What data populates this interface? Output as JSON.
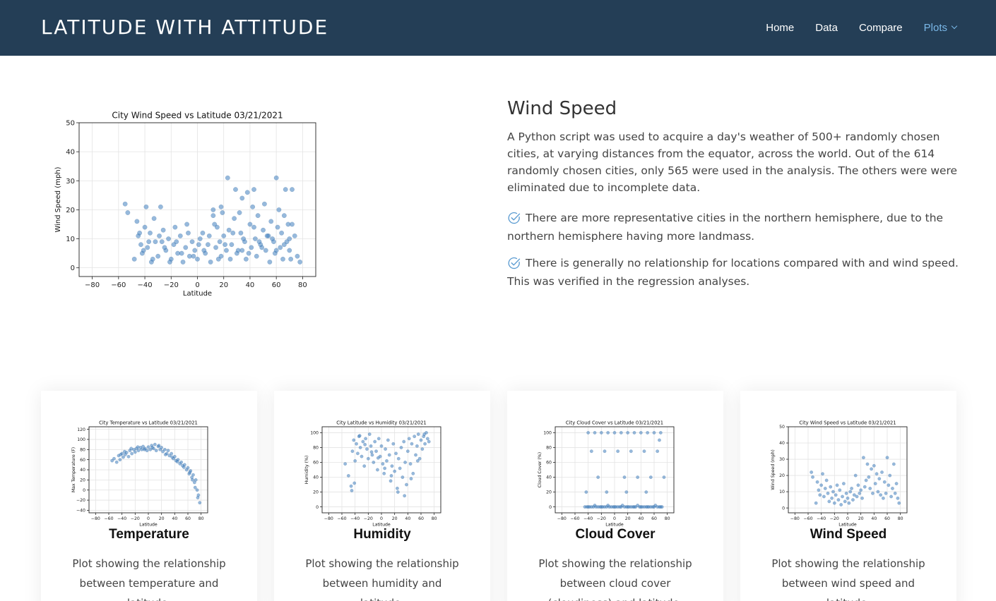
{
  "header": {
    "logo": "LATITUDE WITH ATTITUDE",
    "nav": [
      {
        "label": "Home"
      },
      {
        "label": "Data"
      },
      {
        "label": "Compare"
      },
      {
        "label": "Plots"
      }
    ]
  },
  "main": {
    "title": "Wind Speed",
    "description": "A Python script was used to acquire a day's weather of 500+ randomly chosen cities, at varying distances from the equator, across the world. Out of the 614 randomly chosen cities, only 565 were used in the analysis. The others were were eliminated due to incomplete data.",
    "points": [
      {
        "text": "There are more representative cities in the northern hemisphere, due to the northern hemisphere having more landmass.",
        "icon": "check-circle-icon"
      },
      {
        "text": "There is generally no relationship for locations compared with and wind speed. This was verified in the regression analyses.",
        "icon": "check-circle-icon"
      }
    ]
  },
  "cards": [
    {
      "title": "Temperature",
      "description": "Plot showing the relationship between temperature and latitude."
    },
    {
      "title": "Humidity",
      "description": "Plot showing the relationship between humidity and latitude."
    },
    {
      "title": "Cloud Cover",
      "description": "Plot showing the relationship between cloud cover (cloudiness) and latitude."
    },
    {
      "title": "Wind Speed",
      "description": "Plot showing the relationship between wind speed and latitude."
    }
  ],
  "colors": {
    "header_bg": "#243e56",
    "accent": "#7ab8e8",
    "point": "#3f7fbf"
  },
  "chart_data": [
    {
      "type": "scatter",
      "title": "City Wind Speed vs Latitude 03/21/2021",
      "xlabel": "Latitude",
      "ylabel": "Wind Speed (mph)",
      "xlim": [
        -90,
        90
      ],
      "ylim": [
        -3,
        50
      ],
      "xticks": [
        -80,
        -60,
        -40,
        -20,
        0,
        20,
        40,
        60,
        80
      ],
      "yticks": [
        0,
        10,
        20,
        30,
        40,
        50
      ],
      "grid": true,
      "x": [
        -55,
        -53,
        -48,
        -46,
        -45,
        -43,
        -42,
        -40,
        -39,
        -38,
        -36,
        -35,
        -33,
        -32,
        -30,
        -28,
        -26,
        -24,
        -22,
        -20,
        -18,
        -17,
        -15,
        -13,
        -11,
        -9,
        -8,
        -6,
        -4,
        -2,
        0,
        2,
        4,
        6,
        8,
        10,
        12,
        14,
        15,
        17,
        18,
        20,
        22,
        23,
        24,
        25,
        26,
        28,
        29,
        30,
        32,
        33,
        34,
        36,
        37,
        38,
        40,
        41,
        42,
        44,
        45,
        46,
        48,
        50,
        51,
        52,
        54,
        55,
        56,
        58,
        59,
        60,
        61,
        62,
        63,
        64,
        65,
        66,
        67,
        68,
        69,
        70,
        72,
        74,
        76,
        78,
        -44,
        -41,
        -37,
        -34,
        -29,
        -25,
        -21,
        -16,
        -12,
        -7,
        -3,
        1,
        5,
        9,
        13,
        16,
        19,
        21,
        27,
        31,
        35,
        39,
        43,
        47,
        49,
        53,
        57,
        60,
        66,
        71,
        -27,
        12,
        43,
        18,
        34,
        72,
        70
      ],
      "y": [
        22,
        19,
        3,
        16,
        11,
        8,
        5,
        14,
        21,
        7,
        12,
        2,
        17,
        9,
        4,
        21,
        13,
        6,
        10,
        3,
        8,
        14,
        5,
        11,
        2,
        7,
        15,
        4,
        9,
        6,
        3,
        10,
        12,
        5,
        8,
        2,
        20,
        7,
        14,
        9,
        4,
        11,
        6,
        31,
        13,
        3,
        8,
        17,
        27,
        5,
        19,
        12,
        24,
        9,
        3,
        26,
        15,
        7,
        21,
        10,
        4,
        18,
        8,
        13,
        22,
        6,
        11,
        2,
        16,
        9,
        5,
        31,
        14,
        20,
        7,
        12,
        3,
        18,
        27,
        9,
        15,
        6,
        27,
        11,
        4,
        2,
        12,
        6,
        9,
        3,
        11,
        7,
        2,
        9,
        5,
        12,
        4,
        8,
        6,
        11,
        15,
        3,
        19,
        8,
        12,
        6,
        10,
        5,
        14,
        9,
        7,
        11,
        10,
        6,
        8,
        3,
        9,
        18,
        27,
        21,
        6,
        15,
        10
      ]
    },
    {
      "type": "scatter",
      "title": "City Temperature vs Latitude 03/21/2021",
      "xlabel": "Latitude",
      "ylabel": "Max Temperature (F)",
      "xlim": [
        -90,
        90
      ],
      "ylim": [
        -45,
        125
      ],
      "xticks": [
        -80,
        -60,
        -40,
        -20,
        0,
        20,
        40,
        60,
        80
      ],
      "yticks": [
        -40,
        -20,
        0,
        20,
        40,
        60,
        80,
        100,
        120
      ],
      "grid": true,
      "x": [
        -55,
        -52,
        -48,
        -45,
        -43,
        -40,
        -38,
        -35,
        -33,
        -30,
        -28,
        -25,
        -22,
        -20,
        -18,
        -15,
        -12,
        -10,
        -8,
        -5,
        -2,
        0,
        3,
        5,
        8,
        10,
        12,
        15,
        18,
        20,
        22,
        25,
        28,
        30,
        32,
        35,
        38,
        40,
        42,
        45,
        48,
        50,
        52,
        55,
        58,
        60,
        62,
        64,
        66,
        68,
        70,
        72,
        74,
        76,
        78,
        -42,
        -36,
        -26,
        -16,
        -6,
        6,
        16,
        26,
        36,
        44,
        54,
        63,
        67,
        71,
        75
      ],
      "y": [
        58,
        62,
        55,
        68,
        60,
        72,
        65,
        70,
        74,
        66,
        78,
        72,
        80,
        75,
        82,
        78,
        84,
        80,
        86,
        82,
        78,
        85,
        80,
        88,
        82,
        90,
        78,
        86,
        80,
        84,
        76,
        80,
        72,
        78,
        68,
        72,
        62,
        66,
        58,
        60,
        52,
        55,
        48,
        50,
        40,
        44,
        32,
        38,
        25,
        30,
        15,
        20,
        0,
        -10,
        -25,
        70,
        76,
        82,
        85,
        80,
        84,
        88,
        70,
        65,
        56,
        45,
        35,
        20,
        5,
        -15
      ]
    },
    {
      "type": "scatter",
      "title": "City Latitude vs Humidity 03/21/2021",
      "xlabel": "Latitude",
      "ylabel": "Humidity (%)",
      "xlim": [
        -90,
        90
      ],
      "ylim": [
        -8,
        108
      ],
      "xticks": [
        -80,
        -60,
        -40,
        -20,
        0,
        20,
        40,
        60,
        80
      ],
      "yticks": [
        0,
        20,
        40,
        60,
        80,
        100
      ],
      "grid": true,
      "x": [
        -55,
        -50,
        -46,
        -44,
        -42,
        -40,
        -38,
        -36,
        -34,
        -32,
        -30,
        -28,
        -26,
        -24,
        -22,
        -20,
        -18,
        -16,
        -14,
        -12,
        -10,
        -8,
        -6,
        -4,
        -2,
        0,
        2,
        4,
        6,
        8,
        10,
        12,
        14,
        16,
        18,
        20,
        22,
        24,
        26,
        28,
        30,
        32,
        34,
        36,
        38,
        40,
        42,
        44,
        46,
        48,
        50,
        52,
        54,
        56,
        58,
        60,
        62,
        64,
        66,
        68,
        70,
        72,
        -45,
        -41,
        -33,
        -25,
        -15,
        -5,
        5,
        15,
        25,
        35,
        45,
        55,
        65
      ],
      "y": [
        58,
        42,
        28,
        75,
        90,
        62,
        85,
        72,
        95,
        80,
        68,
        88,
        55,
        92,
        78,
        65,
        98,
        82,
        70,
        60,
        88,
        75,
        50,
        92,
        68,
        82,
        58,
        45,
        78,
        62,
        90,
        70,
        35,
        55,
        85,
        48,
        72,
        25,
        65,
        52,
        80,
        40,
        88,
        60,
        30,
        75,
        92,
        58,
        85,
        45,
        95,
        70,
        82,
        98,
        65,
        90,
        78,
        95,
        85,
        100,
        92,
        88,
        22,
        32,
        96,
        84,
        74,
        66,
        52,
        42,
        20,
        15,
        38,
        62,
        98
      ]
    },
    {
      "type": "scatter",
      "title": "City Cloud Cover vs Latitude 03/21/2021",
      "xlabel": "Latitude",
      "ylabel": "Cloud Cover (%)",
      "xlim": [
        -90,
        90
      ],
      "ylim": [
        -8,
        108
      ],
      "xticks": [
        -80,
        -60,
        -40,
        -20,
        0,
        20,
        40,
        60,
        80
      ],
      "yticks": [
        0,
        20,
        40,
        60,
        80,
        100
      ],
      "grid": true,
      "x": [
        -45,
        -42,
        -40,
        -38,
        -35,
        -32,
        -30,
        -28,
        -25,
        -22,
        -20,
        -18,
        -15,
        -12,
        -10,
        -8,
        -5,
        -2,
        0,
        2,
        5,
        8,
        10,
        12,
        15,
        18,
        20,
        22,
        25,
        28,
        30,
        32,
        35,
        38,
        40,
        42,
        45,
        48,
        50,
        52,
        55,
        58,
        60,
        62,
        65,
        68,
        70,
        72,
        -40,
        -30,
        -20,
        -10,
        0,
        10,
        20,
        30,
        40,
        50,
        60,
        70,
        -35,
        -15,
        5,
        25,
        45,
        65,
        -25,
        15,
        35,
        55,
        75,
        -43,
        -12,
        18,
        48,
        68
      ],
      "y": [
        0,
        0,
        0,
        0,
        0,
        0,
        2,
        0,
        0,
        0,
        0,
        0,
        0,
        0,
        2,
        0,
        0,
        0,
        0,
        0,
        0,
        0,
        0,
        2,
        0,
        0,
        0,
        0,
        0,
        0,
        0,
        0,
        2,
        0,
        0,
        0,
        0,
        0,
        0,
        0,
        0,
        0,
        0,
        2,
        0,
        0,
        0,
        0,
        100,
        100,
        100,
        100,
        100,
        100,
        100,
        100,
        100,
        100,
        100,
        100,
        75,
        75,
        75,
        75,
        75,
        75,
        40,
        40,
        40,
        40,
        40,
        20,
        20,
        20,
        20,
        90
      ]
    },
    {
      "type": "scatter",
      "title": "City Wind Speed vs Latitude 03/21/2021",
      "xlabel": "Latitude",
      "ylabel": "Wind Speed (mph)",
      "xlim": [
        -90,
        90
      ],
      "ylim": [
        -3,
        50
      ],
      "xticks": [
        -80,
        -60,
        -40,
        -20,
        0,
        20,
        40,
        60,
        80
      ],
      "yticks": [
        0,
        10,
        20,
        30,
        40,
        50
      ],
      "grid": true,
      "x": [
        -55,
        -53,
        -48,
        -46,
        -44,
        -42,
        -40,
        -38,
        -36,
        -34,
        -32,
        -30,
        -28,
        -26,
        -24,
        -22,
        -20,
        -18,
        -16,
        -14,
        -12,
        -10,
        -8,
        -6,
        -4,
        -2,
        0,
        2,
        4,
        6,
        8,
        10,
        12,
        14,
        16,
        18,
        20,
        22,
        24,
        26,
        28,
        30,
        32,
        34,
        36,
        38,
        40,
        42,
        44,
        46,
        48,
        50,
        52,
        54,
        56,
        58,
        60,
        62,
        64,
        66,
        68,
        70,
        72,
        74,
        76,
        78
      ],
      "y": [
        22,
        19,
        3,
        16,
        11,
        8,
        14,
        21,
        7,
        12,
        17,
        9,
        4,
        13,
        6,
        10,
        3,
        8,
        14,
        5,
        11,
        2,
        7,
        15,
        4,
        9,
        6,
        3,
        10,
        12,
        5,
        8,
        20,
        7,
        14,
        9,
        11,
        6,
        31,
        13,
        17,
        27,
        19,
        12,
        24,
        9,
        26,
        15,
        21,
        10,
        18,
        8,
        22,
        6,
        16,
        9,
        31,
        14,
        20,
        7,
        12,
        27,
        9,
        15,
        6,
        3
      ]
    }
  ]
}
